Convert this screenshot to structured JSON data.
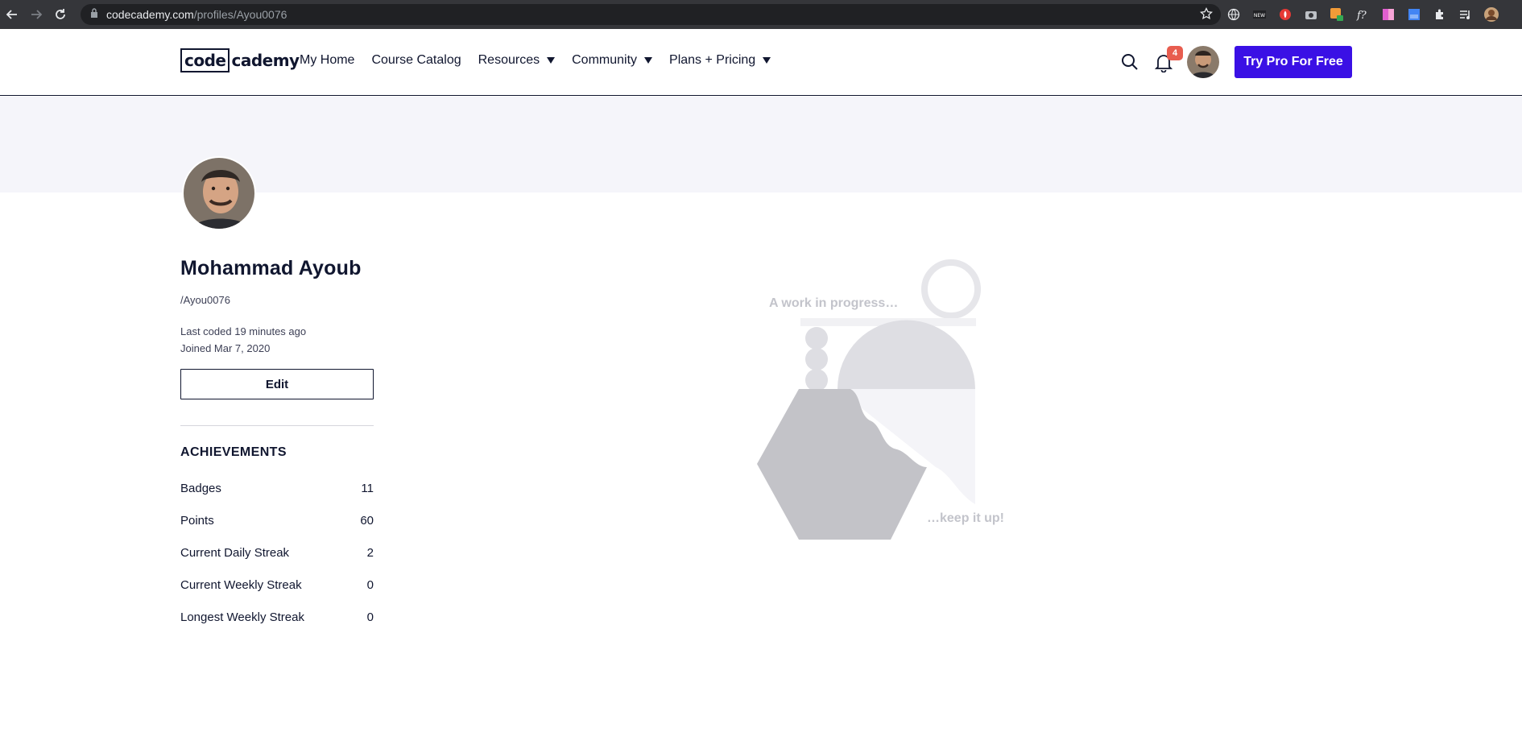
{
  "browser": {
    "url_host": "codecademy.com",
    "url_path": "/profiles/Ayou0076"
  },
  "header": {
    "logo_boxed": "code",
    "logo_rest": "cademy",
    "nav": [
      {
        "label": "My Home"
      },
      {
        "label": "Course Catalog"
      },
      {
        "label": "Resources"
      },
      {
        "label": "Community"
      },
      {
        "label": "Plans + Pricing"
      }
    ],
    "notification_count": "4",
    "cta_label": "Try Pro For Free"
  },
  "profile": {
    "name": "Mohammad Ayoub",
    "handle": "/Ayou0076",
    "last_coded": "Last coded 19 minutes ago",
    "joined": "Joined Mar 7, 2020",
    "edit_label": "Edit"
  },
  "achievements": {
    "title": "ACHIEVEMENTS",
    "items": [
      {
        "label": "Badges",
        "value": "11"
      },
      {
        "label": "Points",
        "value": "60"
      },
      {
        "label": "Current Daily Streak",
        "value": "2"
      },
      {
        "label": "Current Weekly Streak",
        "value": "0"
      },
      {
        "label": "Longest Weekly Streak",
        "value": "0"
      }
    ]
  },
  "illustration": {
    "text_top": "A work in progress…",
    "text_bottom": "…keep it up!"
  },
  "colors": {
    "accent": "#3a10e5",
    "badge": "#e85d4f",
    "hero_bg": "#f5f5fa",
    "text": "#10162f"
  }
}
